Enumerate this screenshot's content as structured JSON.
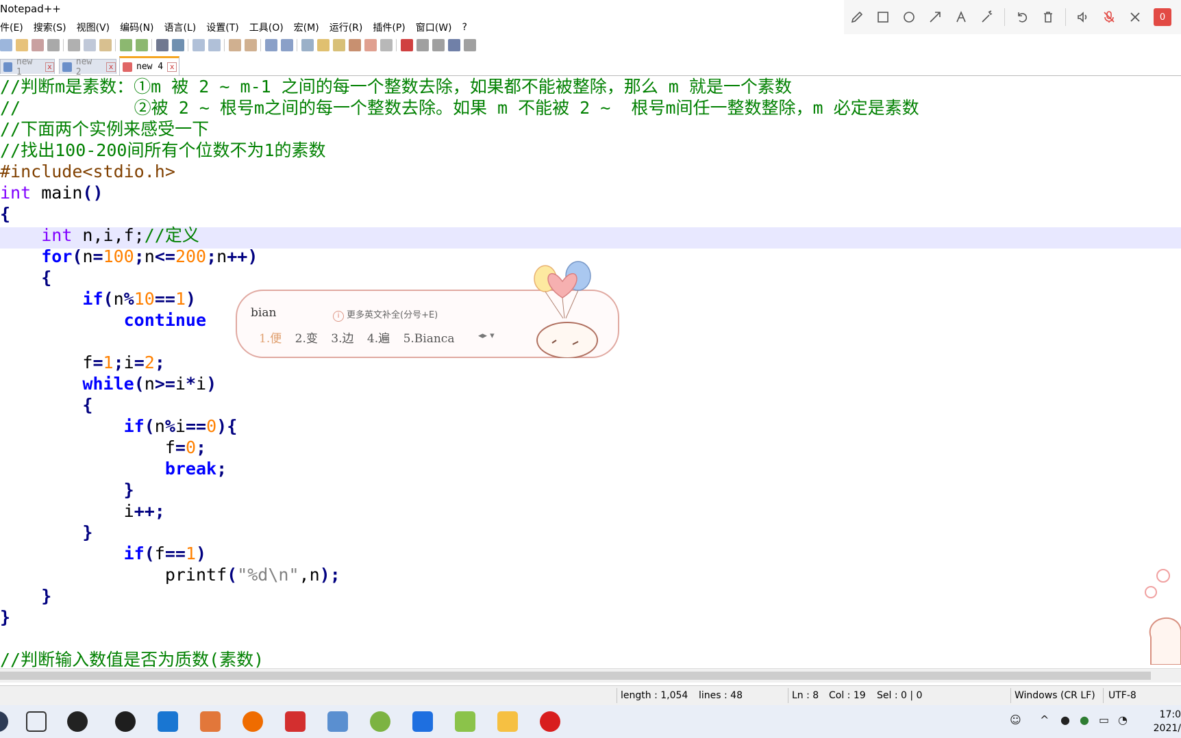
{
  "window": {
    "title": "Notepad++"
  },
  "menu": [
    "件(E)",
    "搜索(S)",
    "视图(V)",
    "编码(N)",
    "语言(L)",
    "设置(T)",
    "工具(O)",
    "宏(M)",
    "运行(R)",
    "插件(P)",
    "窗口(W)",
    "?"
  ],
  "tabs": [
    {
      "label": "new 1",
      "close": "x"
    },
    {
      "label": "new 2",
      "close": "x"
    },
    {
      "label": "new 4",
      "close": "x"
    }
  ],
  "code": {
    "l1": "//判断m是素数：①m 被 2 ~ m-1 之间的每一个整数去除，如果都不能被整除，那么 m 就是一个素数",
    "l2": "//           ②被 2 ~ 根号m之间的每一个整数去除。如果 m 不能被 2 ~  根号m间任一整数整除，m 必定是素数",
    "l3": "//下面两个实例来感受一下",
    "l4": "//找出100-200间所有个位数不为1的素数",
    "l5": "#include<stdio.h>",
    "int_kw": "int",
    "main_name": " main",
    "paren_pair": "()",
    "brace_open": "{",
    "brace_close": "}",
    "decl_vars": " n,i,f;",
    "decl_comment": "//定义",
    "for_kw": "for",
    "lp": "(",
    "rp": ")",
    "n": "n",
    "i": "i",
    "f": "f",
    "eq": "=",
    "semi": ";",
    "le": "<=",
    "inc": "++",
    "ge": ">=",
    "mul": "*",
    "mod": "%",
    "eqeq": "==",
    "n100": "100",
    "n200": "200",
    "n10": "10",
    "n1": "1",
    "n2": "2",
    "n0": "0",
    "if_kw": "if",
    "continue_kw": "continue",
    "while_kw": "while",
    "break_kw": "break",
    "printf": "printf",
    "fmt": "\"%d\\n\"",
    "comma_n": ",n",
    "last_comment": "//判断输入数值是否为质数(素数)"
  },
  "ime": {
    "pinyin": "bian",
    "hint": "更多英文补全(分号+E)",
    "hint_icon": "i",
    "candidates": [
      "1.便",
      "2.变",
      "3.边",
      "4.遍",
      "5.Bianca"
    ]
  },
  "status": {
    "length": "length : 1,054",
    "lines": "lines : 48",
    "ln": "Ln : 8",
    "col": "Col : 19",
    "sel": "Sel : 0 | 0",
    "eol": "Windows (CR LF)",
    "encoding": "UTF-8"
  },
  "annotation_toolbar": {
    "record_label": "0"
  },
  "taskbar": {
    "time": "17:0",
    "date": "2021/"
  },
  "colors": {
    "comment": "#008000",
    "keyword": "#0000ff",
    "type": "#8000ff",
    "number": "#ff8000",
    "operator": "#000080",
    "active_line": "#e8e8ff",
    "active_tab_accent": "#f5a623"
  }
}
